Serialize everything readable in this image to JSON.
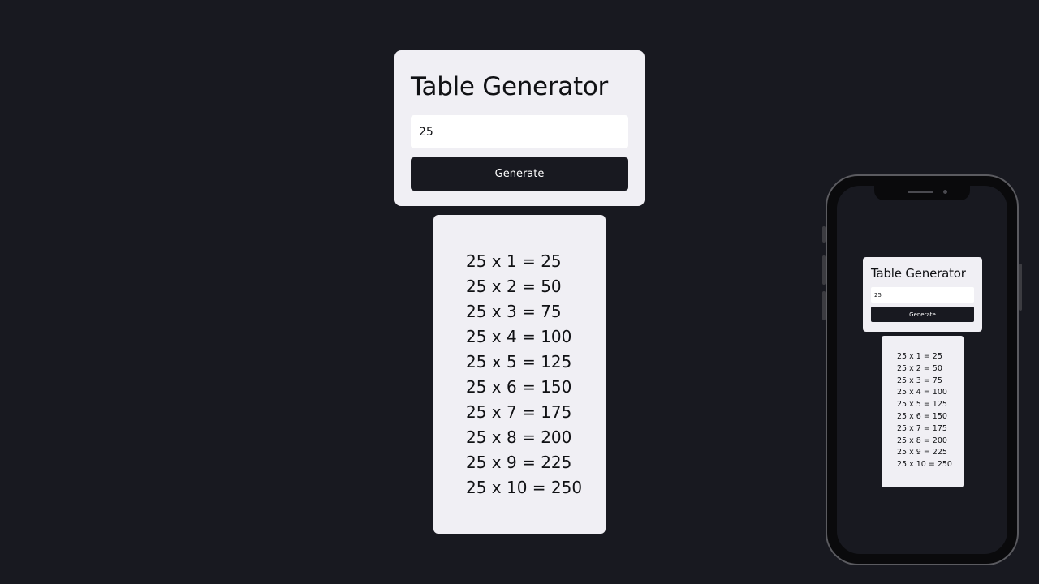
{
  "app": {
    "title": "Table Generator",
    "input_value": "25",
    "button_label": "Generate"
  },
  "results": [
    "25 x 1 = 25",
    "25 x 2 = 50",
    "25 x 3 = 75",
    "25 x 4 = 100",
    "25 x 5 = 125",
    "25 x 6 = 150",
    "25 x 7 = 175",
    "25 x 8 = 200",
    "25 x 9 = 225",
    "25 x 10 = 250"
  ],
  "colors": {
    "background": "#181920",
    "card": "#f0eff4",
    "button": "#181920",
    "text": "#101114"
  }
}
